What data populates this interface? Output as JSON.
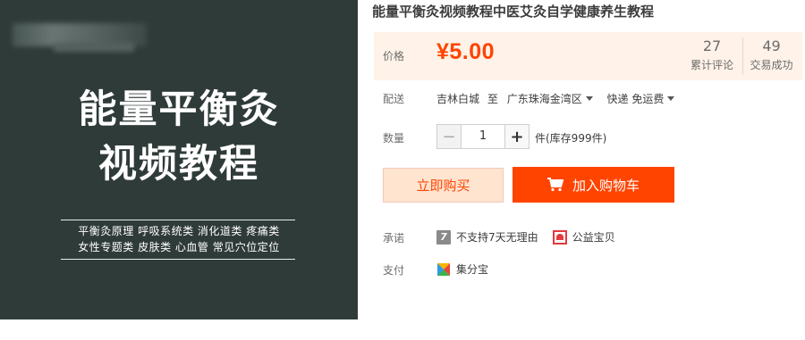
{
  "cover": {
    "title_line1": "能量平衡灸",
    "title_line2": "视频教程",
    "subtitle_line1": "平衡灸原理 呼吸系统类 消化道类 疼痛类",
    "subtitle_line2": "女性专题类 皮肤类 心血管 常见穴位定位"
  },
  "product": {
    "title": "能量平衡灸视频教程中医艾灸自学健康养生教程"
  },
  "price": {
    "label": "价格",
    "value": "¥5.00",
    "reviews_count": "27",
    "reviews_label": "累计评论",
    "deals_count": "49",
    "deals_label": "交易成功"
  },
  "shipping": {
    "label": "配送",
    "origin": "吉林白城",
    "to": "至",
    "destination": "广东珠海金湾区",
    "method": "快递 免运费"
  },
  "quantity": {
    "label": "数量",
    "minus": "−",
    "value": "1",
    "plus": "+",
    "stock": "件(库存999件)"
  },
  "actions": {
    "buy_now": "立即购买",
    "add_cart": "加入购物车"
  },
  "promise": {
    "label": "承诺",
    "item1": "不支持7天无理由",
    "item2": "公益宝贝"
  },
  "payment": {
    "label": "支付",
    "method": "集分宝"
  },
  "colors": {
    "accent": "#ff4400",
    "price_bg": "#fff2e8",
    "cover_bg": "#2f3b39"
  }
}
